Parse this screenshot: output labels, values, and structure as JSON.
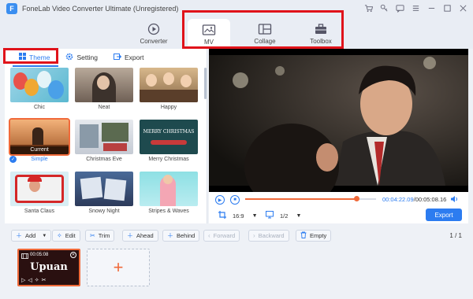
{
  "app": {
    "title": "FoneLab Video Converter Ultimate (Unregistered)",
    "logo": "F",
    "title_icons": [
      "cart-icon",
      "key-icon",
      "chat-icon",
      "menu-icon",
      "minimize-icon",
      "maximize-icon",
      "close-icon"
    ]
  },
  "nav": {
    "items": [
      {
        "label": "Converter",
        "icon": "converter-icon"
      },
      {
        "label": "MV",
        "icon": "mv-icon",
        "active": true
      },
      {
        "label": "Collage",
        "icon": "collage-icon"
      },
      {
        "label": "Toolbox",
        "icon": "toolbox-icon"
      }
    ]
  },
  "left_panel": {
    "tabs": [
      {
        "label": "Theme",
        "active": true
      },
      {
        "label": "Setting"
      },
      {
        "label": "Export"
      }
    ],
    "themes": [
      {
        "label": "Chic"
      },
      {
        "label": "Neat"
      },
      {
        "label": "Happy"
      },
      {
        "label": "Simple",
        "selected": true,
        "tag": "Current"
      },
      {
        "label": "Christmas Eve"
      },
      {
        "label": "Merry Christmas"
      },
      {
        "label": "Santa Claus"
      },
      {
        "label": "Snowy Night"
      },
      {
        "label": "Stripes & Waves"
      }
    ],
    "thumb_text": {
      "merry": "MERRY CHRISTMAS"
    }
  },
  "player": {
    "current_time": "00:04:22.09",
    "total_time": "/00:05:08.16",
    "progress": 0.85,
    "aspect": "16:9",
    "screen": "1/2",
    "export_label": "Export"
  },
  "toolbar": {
    "buttons": [
      {
        "label": "Add",
        "icon": "plus-icon",
        "dropdown": true
      },
      {
        "label": "Edit",
        "icon": "wand-icon"
      },
      {
        "label": "Trim",
        "icon": "scissors-icon"
      },
      {
        "label": "Ahead",
        "icon": "plus-icon"
      },
      {
        "label": "Behind",
        "icon": "plus-icon"
      },
      {
        "label": "Forward",
        "icon": "chevron-left-icon",
        "disabled": true
      },
      {
        "label": "Backward",
        "icon": "chevron-right-icon",
        "disabled": true
      },
      {
        "label": "Empty",
        "icon": "trash-icon"
      }
    ],
    "page": "1 / 1"
  },
  "timeline": {
    "clip": {
      "duration": "00:05:08",
      "title": "Upuan"
    },
    "add_symbol": "+"
  },
  "colors": {
    "accent": "#2c7cf0",
    "highlight": "#f06a3a",
    "annotation": "#e0131a"
  }
}
